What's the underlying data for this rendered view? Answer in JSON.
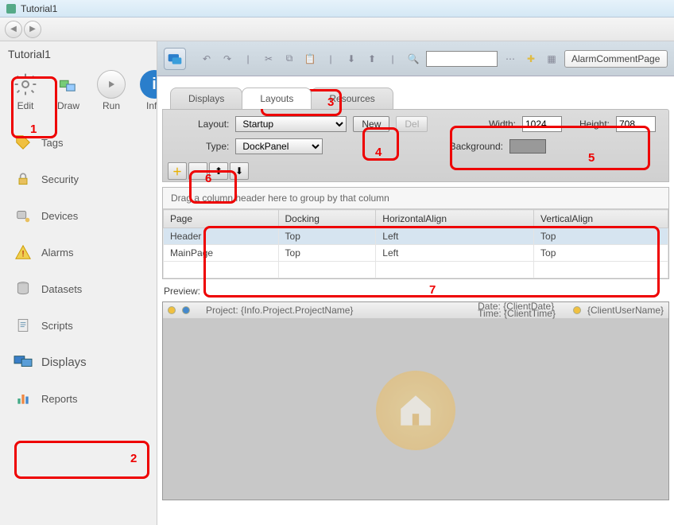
{
  "window_title": "Tutorial1",
  "project_title": "Tutorial1",
  "modes": {
    "edit": "Edit",
    "draw": "Draw",
    "run": "Run",
    "info": "Info"
  },
  "sidebar": {
    "items": [
      {
        "label": "Tags"
      },
      {
        "label": "Security"
      },
      {
        "label": "Devices"
      },
      {
        "label": "Alarms"
      },
      {
        "label": "Datasets"
      },
      {
        "label": "Scripts"
      },
      {
        "label": "Displays"
      },
      {
        "label": "Reports"
      }
    ]
  },
  "toolbar": {
    "alarm_button": "AlarmCommentPage"
  },
  "tabs": {
    "displays": "Displays",
    "layouts": "Layouts",
    "resources": "Resources"
  },
  "layout_panel": {
    "layout_label": "Layout:",
    "layout_value": "Startup",
    "new_label": "New",
    "del_label": "Del",
    "type_label": "Type:",
    "type_value": "DockPanel",
    "width_label": "Width:",
    "width_value": "1024",
    "height_label": "Height:",
    "height_value": "708",
    "background_label": "Background:"
  },
  "grid": {
    "group_hint": "Drag a column header here to group by that column",
    "cols": {
      "page": "Page",
      "docking": "Docking",
      "halign": "HorizontalAlign",
      "valign": "VerticalAlign"
    },
    "rows": [
      {
        "page": "Header",
        "docking": "Top",
        "halign": "Left",
        "valign": "Top"
      },
      {
        "page": "MainPage",
        "docking": "Top",
        "halign": "Left",
        "valign": "Top"
      }
    ]
  },
  "preview": {
    "label": "Preview:",
    "project_text": "Project: {Info.Project.ProjectName}",
    "date_text": "Date: {ClientDate}",
    "time_text": "Time: {ClientTime}",
    "user_text": "{ClientUserName}"
  },
  "annotations": {
    "a1": "1",
    "a2": "2",
    "a3": "3",
    "a4": "4",
    "a5": "5",
    "a6": "6",
    "a7": "7"
  }
}
